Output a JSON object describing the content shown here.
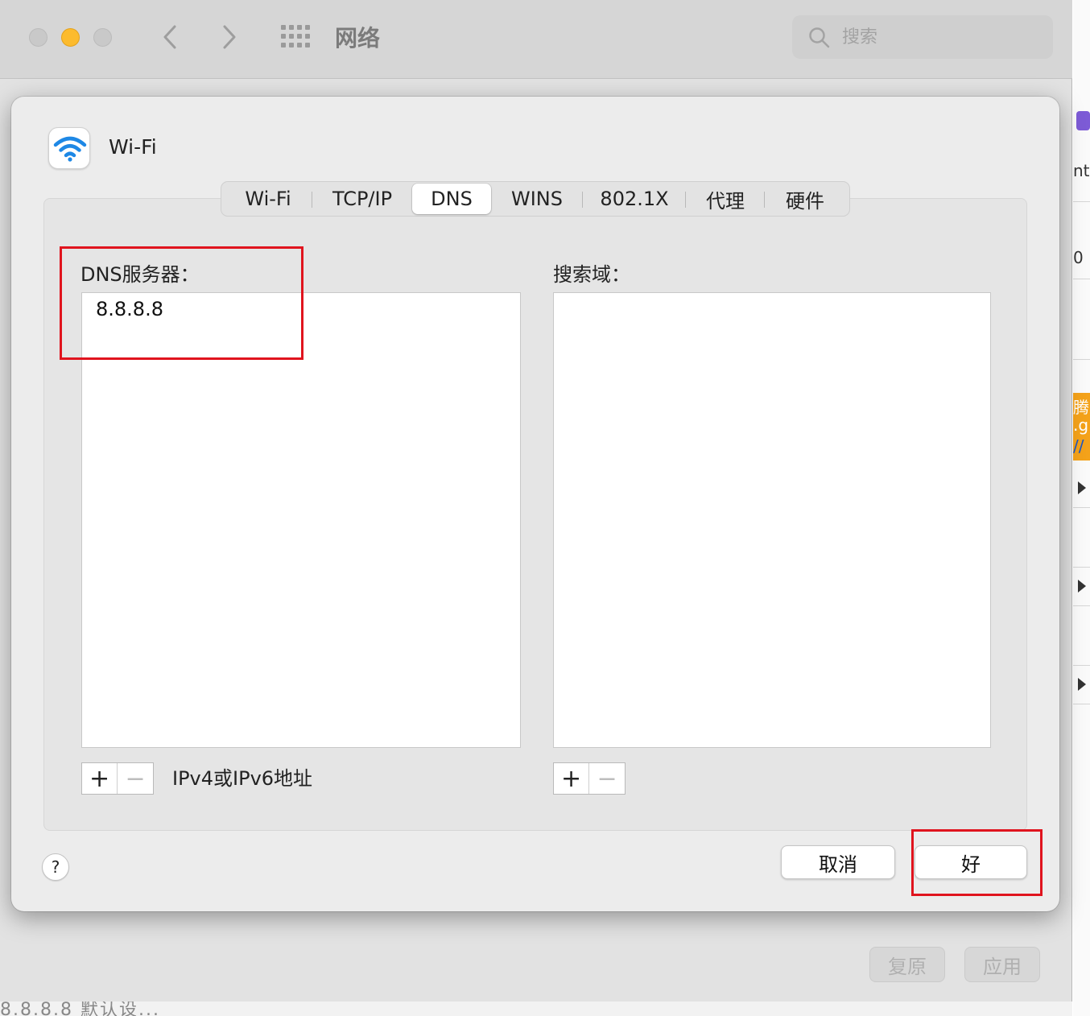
{
  "window": {
    "title": "网络",
    "search_placeholder": "搜索",
    "revert_label": "复原",
    "apply_label": "应用",
    "bottom_text": "8.8.8.8 默认设..."
  },
  "sheet": {
    "interface_name": "Wi-Fi",
    "tabs": [
      {
        "label": "Wi-Fi",
        "active": false
      },
      {
        "label": "TCP/IP",
        "active": false
      },
      {
        "label": "DNS",
        "active": true
      },
      {
        "label": "WINS",
        "active": false
      },
      {
        "label": "802.1X",
        "active": false
      },
      {
        "label": "代理",
        "active": false
      },
      {
        "label": "硬件",
        "active": false
      }
    ],
    "dns": {
      "label": "DNS服务器：",
      "servers": [
        "8.8.8.8"
      ],
      "hint": "IPv4或IPv6地址"
    },
    "search_domains": {
      "label": "搜索域：",
      "domains": []
    },
    "plus_label": "+",
    "minus_label": "−",
    "help_label": "?",
    "cancel_label": "取消",
    "ok_label": "好"
  },
  "side_app": {
    "text_1": "nts",
    "text_2": "0",
    "text_3": "腾",
    "text_4": ".g",
    "text_5": "//"
  },
  "colors": {
    "annotation": "#e0141e",
    "wifi_blue": "#1e88e5",
    "minimize_yellow": "#fcbb2e"
  },
  "icons": {
    "wifi": "wifi-icon",
    "search": "search-icon",
    "grid": "grid-icon",
    "back": "chevron-left-icon",
    "forward": "chevron-right-icon"
  }
}
